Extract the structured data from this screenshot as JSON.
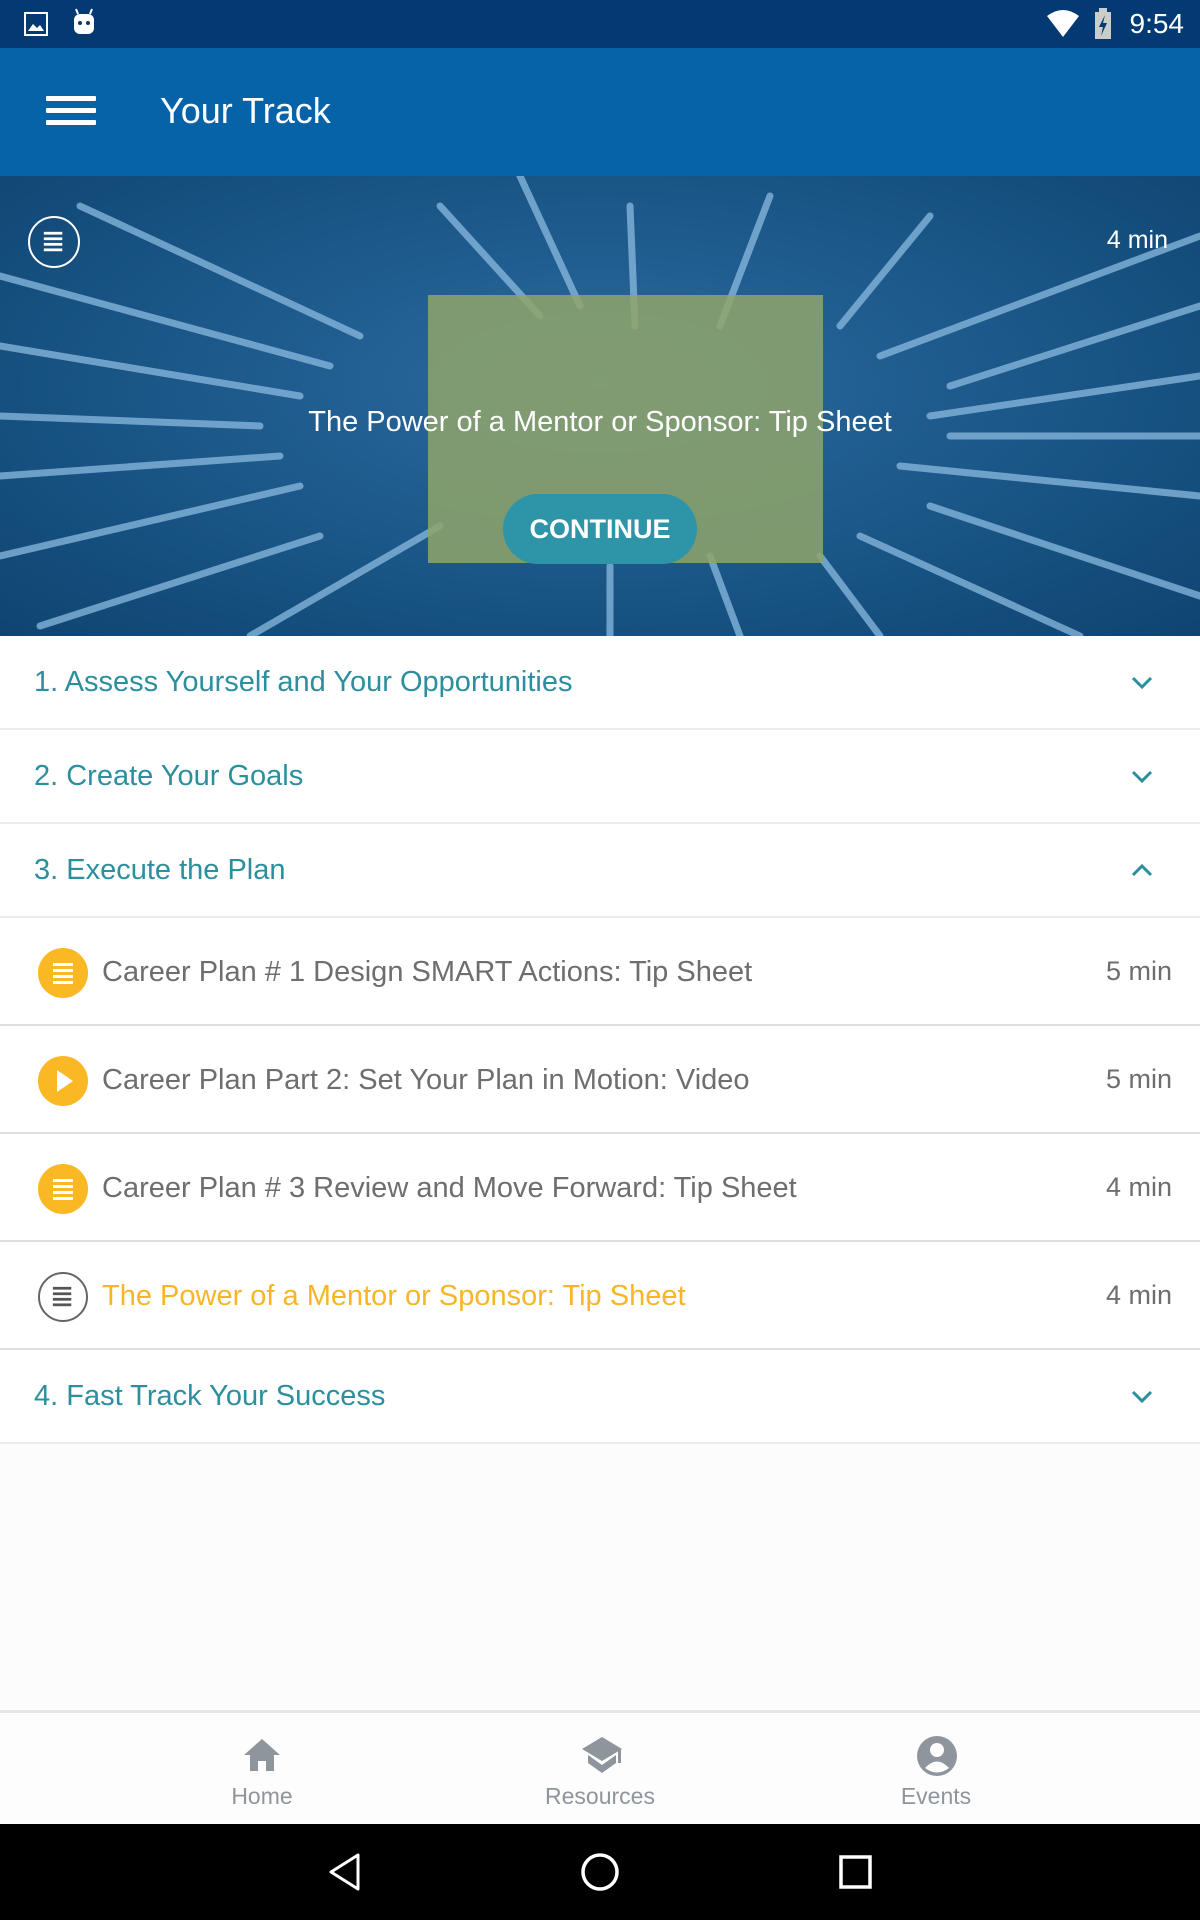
{
  "status_bar": {
    "time": "9:54"
  },
  "app_bar": {
    "title": "Your Track"
  },
  "hero": {
    "duration": "4 min",
    "title": "The Power of a Mentor or Sponsor: Tip Sheet",
    "continue_label": "CONTINUE"
  },
  "sections": [
    {
      "label": "1. Assess Yourself and Your Opportunities",
      "expanded": false
    },
    {
      "label": "2. Create Your Goals",
      "expanded": false
    },
    {
      "label": "3. Execute the Plan",
      "expanded": true
    },
    {
      "label": "4. Fast Track Your Success",
      "expanded": false
    }
  ],
  "items": [
    {
      "label": "Career Plan # 1 Design SMART Actions: Tip Sheet",
      "duration": "5 min",
      "icon": "document-icon"
    },
    {
      "label": "Career Plan Part 2: Set Your Plan in Motion: Video",
      "duration": "5 min",
      "icon": "play-icon"
    },
    {
      "label": "Career Plan # 3 Review and Move Forward: Tip Sheet",
      "duration": "4 min",
      "icon": "document-icon"
    },
    {
      "label": "The Power of a Mentor or Sponsor: Tip Sheet",
      "duration": "4 min",
      "icon": "document-icon",
      "active": true
    }
  ],
  "bottom_nav": [
    {
      "label": "Home",
      "icon": "home-icon"
    },
    {
      "label": "Resources",
      "icon": "graduation-cap-icon"
    },
    {
      "label": "Events",
      "icon": "user-circle-icon"
    }
  ],
  "colors": {
    "status_bar": "#033a73",
    "app_bar": "#0663a7",
    "accent_teal": "#2b8f9e",
    "completed_yellow": "#fbb825",
    "active_text": "#f8b627"
  }
}
